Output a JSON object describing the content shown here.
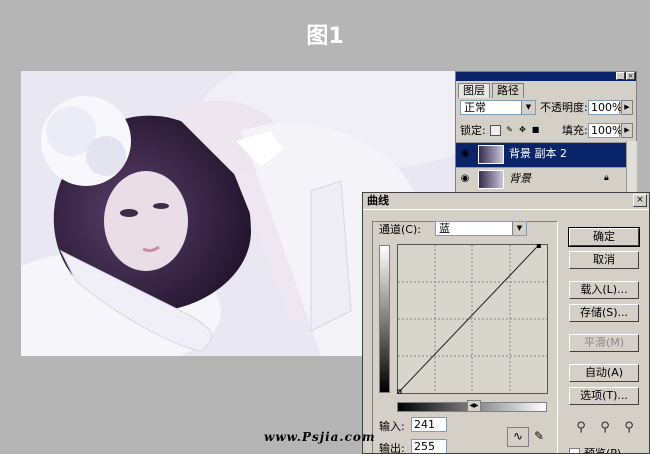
{
  "figure_title": "图1",
  "watermark": "www.Psjia.com",
  "layers_panel": {
    "tabs": [
      "图层",
      "路径"
    ],
    "blend_mode": "正常",
    "opacity_label": "不透明度:",
    "opacity_value": "100%",
    "lock_label": "锁定:",
    "fill_label": "填充:",
    "fill_value": "100%",
    "layers": [
      {
        "name": "背景 副本 2",
        "selected": true,
        "visible": true
      },
      {
        "name": "背景",
        "selected": false,
        "visible": true,
        "locked": true
      }
    ]
  },
  "curves_dialog": {
    "title": "曲线",
    "channel_label": "通道(C):",
    "channel_value": "蓝",
    "input_label": "输入:",
    "input_value": "241",
    "output_label": "输出:",
    "output_value": "255",
    "preview_label": "预览(P)",
    "buttons": {
      "ok": "确定",
      "cancel": "取消",
      "load": "载入(L)...",
      "save": "存储(S)...",
      "smooth": "平滑(M)",
      "auto": "自动(A)",
      "options": "选项(T)..."
    },
    "curve_points": [
      [
        0,
        0
      ],
      [
        241,
        255
      ]
    ]
  },
  "colors": {
    "selection": "#0a246a",
    "dialog_bg": "#d4d0c8",
    "canvas_bg": "#b5b5b5"
  }
}
